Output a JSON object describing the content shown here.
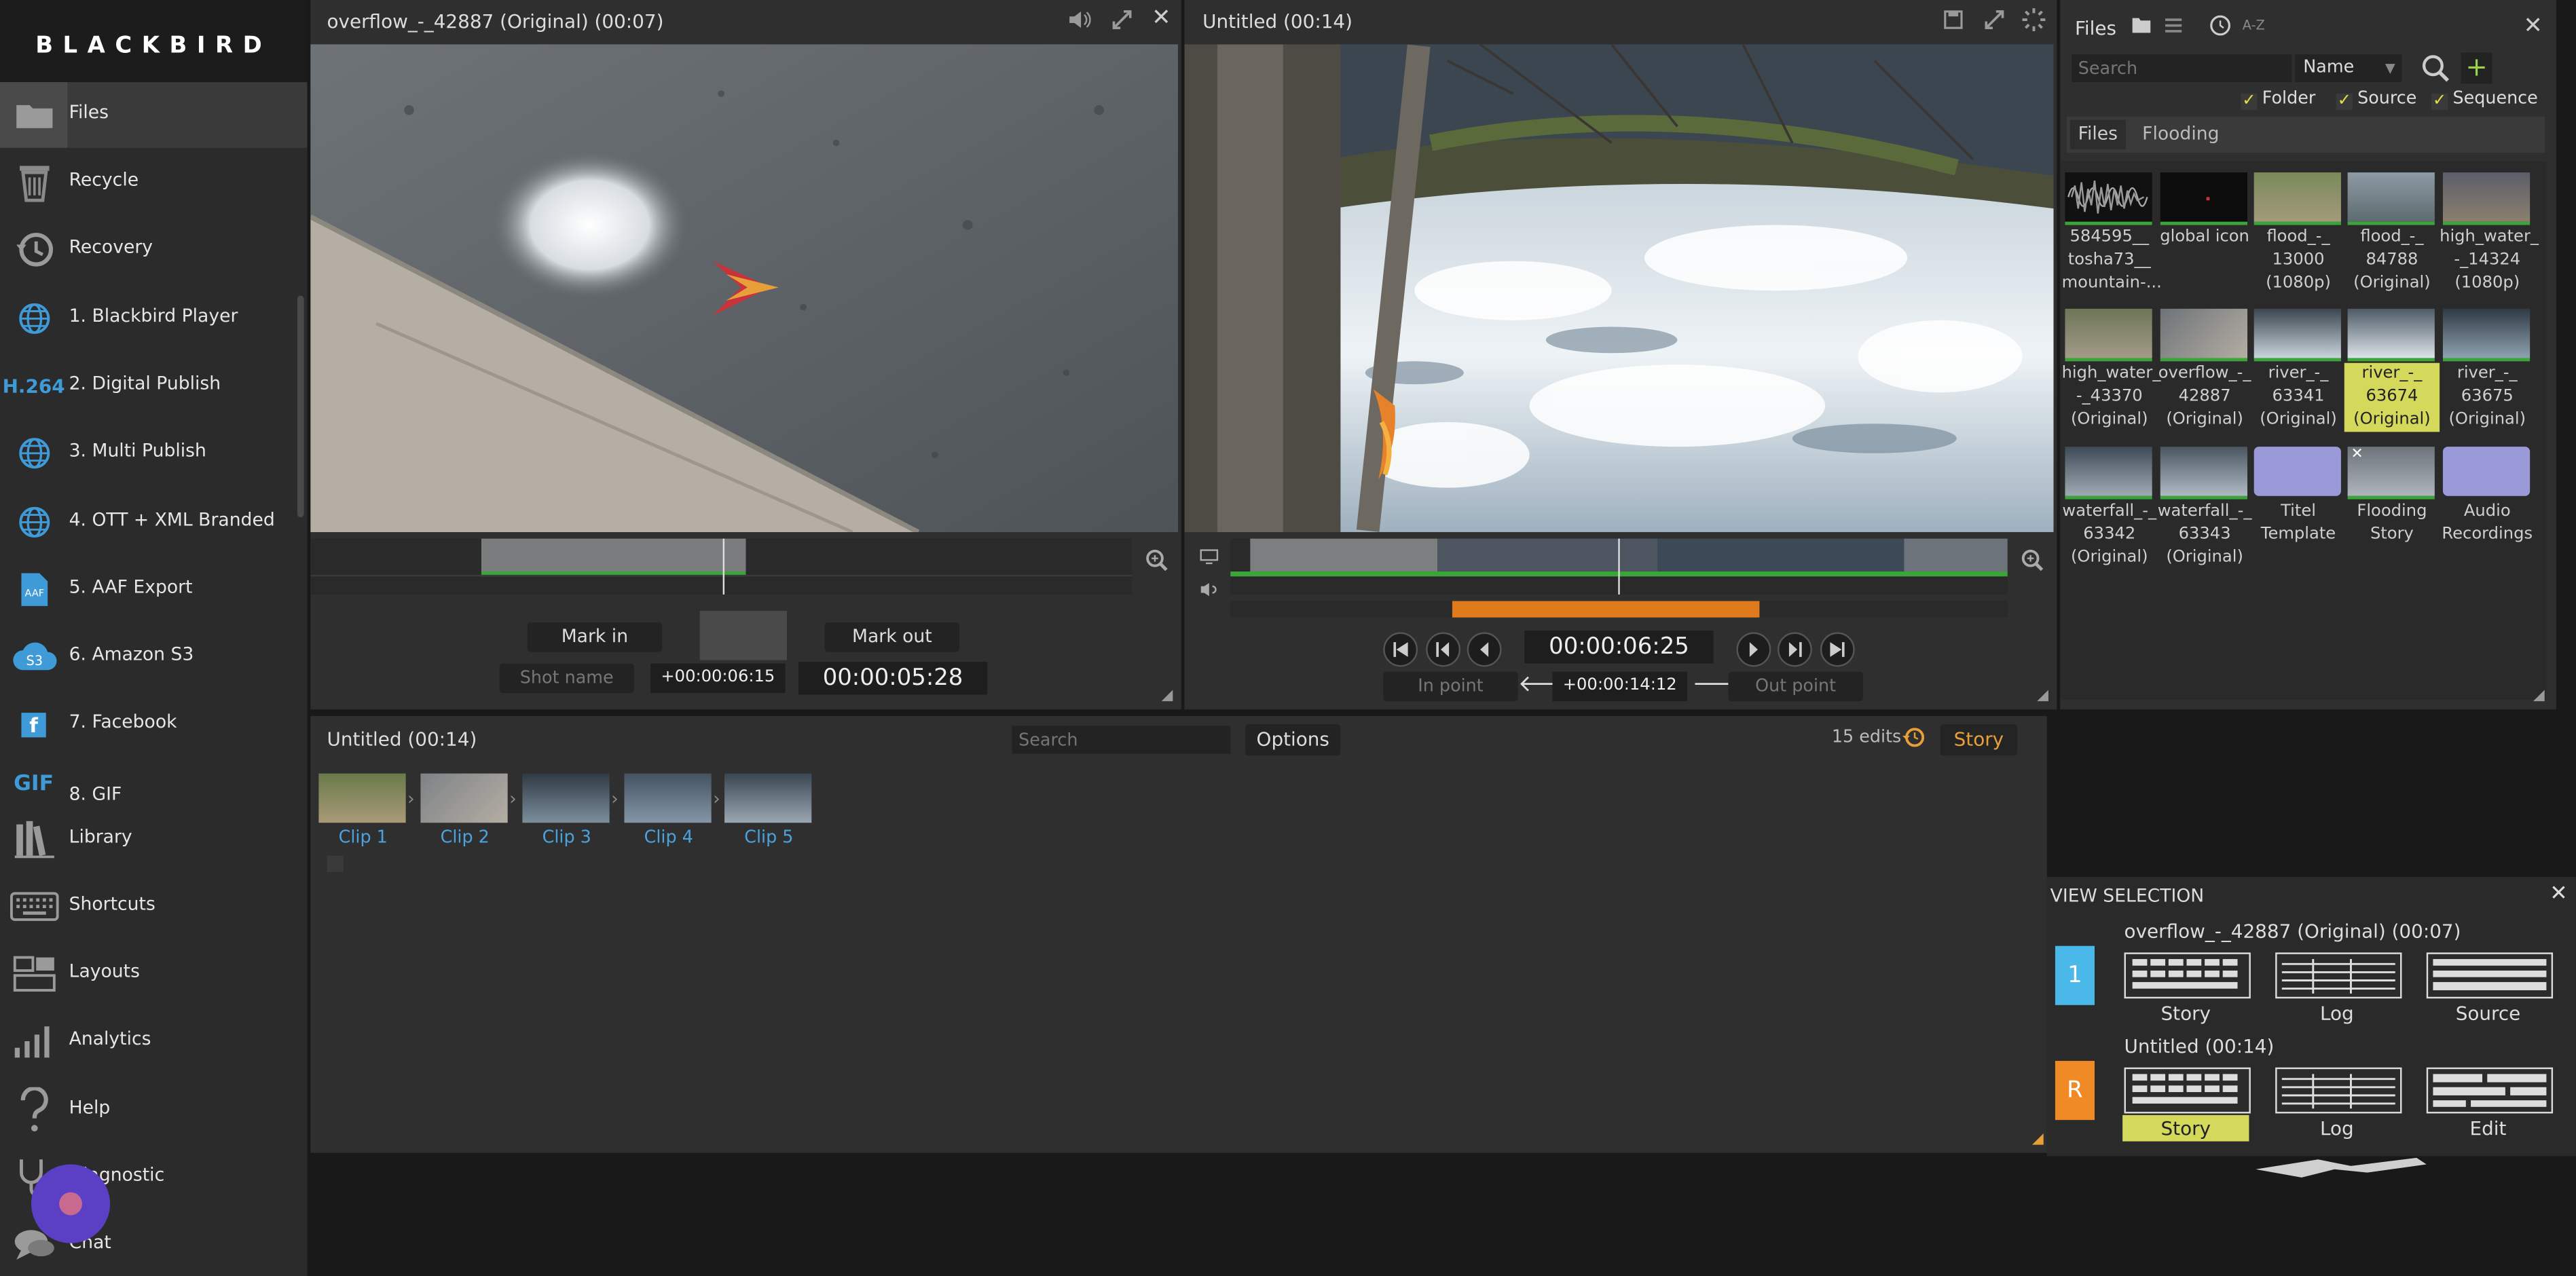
{
  "app": {
    "logo": "BLACKBIRD"
  },
  "sidebar": {
    "items": [
      {
        "label": "Files",
        "icon": "folder-icon"
      },
      {
        "label": "Recycle",
        "icon": "recycle-icon"
      },
      {
        "label": "Recovery",
        "icon": "history-icon"
      },
      {
        "label": "1. Blackbird Player",
        "icon": "globe-icon"
      },
      {
        "label": "2. Digital Publish",
        "icon": "h264-icon"
      },
      {
        "label": "3. Multi Publish",
        "icon": "globe-icon"
      },
      {
        "label": "4. OTT + XML Branded",
        "icon": "globe-icon"
      },
      {
        "label": "5. AAF Export",
        "icon": "aaf-icon"
      },
      {
        "label": "6. Amazon S3",
        "icon": "s3-icon"
      },
      {
        "label": "7. Facebook",
        "icon": "facebook-icon"
      },
      {
        "label": "8. GIF",
        "icon": "gif-icon"
      },
      {
        "label": "Library",
        "icon": "library-icon"
      },
      {
        "label": "Shortcuts",
        "icon": "keyboard-icon"
      },
      {
        "label": "Layouts",
        "icon": "layouts-icon"
      },
      {
        "label": "Analytics",
        "icon": "analytics-icon"
      },
      {
        "label": "Help",
        "icon": "help-icon"
      },
      {
        "label": "Diagnostic",
        "icon": "stethoscope-icon"
      },
      {
        "label": "Chat",
        "icon": "chat-icon"
      }
    ],
    "h264_text": "H.264",
    "gif_text": "GIF",
    "aaf_text": "AAF",
    "s3_text": "S3",
    "fb_text": "f"
  },
  "source_viewer": {
    "title": "overflow_-_42887 (Original) (00:07)",
    "mark_in": "Mark in",
    "mark_out": "Mark out",
    "shot_name": "Shot name",
    "offset": "+00:00:06:15",
    "timecode": "00:00:05:28"
  },
  "record_viewer": {
    "title": "Untitled (00:14)",
    "timecode": "00:00:06:25",
    "in_point": "In point",
    "out_point": "Out point",
    "offset": "+00:00:14:12"
  },
  "files_panel": {
    "title": "Files",
    "sort": "A-Z",
    "search_placeholder": "Search",
    "sort_select": "Name",
    "filters": {
      "folder": "Folder",
      "source": "Source",
      "sequence": "Sequence"
    },
    "breadcrumb": [
      "Files",
      "Flooding"
    ],
    "items": [
      {
        "l1": "584595__",
        "l2": "tosha73__",
        "l3": "mountain-..."
      },
      {
        "l1": "global icon",
        "l2": "",
        "l3": ""
      },
      {
        "l1": "flood_-_",
        "l2": "13000",
        "l3": "(1080p)"
      },
      {
        "l1": "flood_-_",
        "l2": "84788",
        "l3": "(Original)"
      },
      {
        "l1": "high_water_",
        "l2": "-_14324",
        "l3": "(1080p)"
      },
      {
        "l1": "high_water_",
        "l2": "-_43370",
        "l3": "(Original)"
      },
      {
        "l1": "overflow_-_",
        "l2": "42887",
        "l3": "(Original)"
      },
      {
        "l1": "river_-_",
        "l2": "63341",
        "l3": "(Original)"
      },
      {
        "l1": "river_-_",
        "l2": "63674",
        "l3": "(Original)"
      },
      {
        "l1": "river_-_",
        "l2": "63675",
        "l3": "(Original)"
      },
      {
        "l1": "waterfall_-_",
        "l2": "63342",
        "l3": "(Original)"
      },
      {
        "l1": "waterfall_-_",
        "l2": "63343",
        "l3": "(Original)"
      },
      {
        "l1": "Titel",
        "l2": "Template",
        "l3": ""
      },
      {
        "l1": "Flooding",
        "l2": "Story",
        "l3": ""
      },
      {
        "l1": "Audio",
        "l2": "Recordings",
        "l3": ""
      }
    ]
  },
  "storyboard": {
    "title": "Untitled (00:14)",
    "search_placeholder": "Search",
    "options": "Options",
    "edits": "15 edits",
    "story_tab": "Story",
    "clips": [
      "Clip 1",
      "Clip 2",
      "Clip 3",
      "Clip 4",
      "Clip 5"
    ]
  },
  "view_selection": {
    "title": "VIEW SELECTION",
    "source_badge": "1",
    "source_name": "overflow_-_42887 (Original) (00:07)",
    "source_layouts": [
      "Story",
      "Log",
      "Source"
    ],
    "record_badge": "R",
    "record_name": "Untitled (00:14)",
    "record_layouts": [
      "Story",
      "Log",
      "Edit"
    ]
  },
  "colors": {
    "accent": "#e89f3a",
    "selected": "#d4d85b",
    "badge_blue": "#4ab8e8",
    "badge_orange": "#f08a24",
    "link": "#4aa3df"
  }
}
